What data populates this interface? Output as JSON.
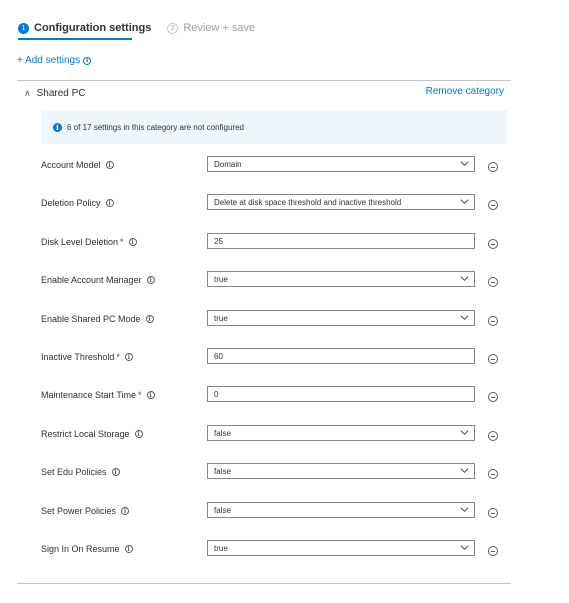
{
  "steps": [
    {
      "number": "1",
      "label": "Configuration settings"
    },
    {
      "number": "2",
      "label": "Review + save"
    }
  ],
  "add_settings_label": "+ Add settings",
  "info_glyph": "i",
  "category": {
    "title": "Shared PC",
    "remove_label": "Remove category",
    "banner_text": "6 of 17 settings in this category are not configured"
  },
  "settings": [
    {
      "label": "Account Model",
      "required": false,
      "type": "dropdown",
      "value": "Domain"
    },
    {
      "label": "Deletion Policy",
      "required": false,
      "type": "dropdown",
      "value": "Delete at disk space threshold and inactive threshold"
    },
    {
      "label": "Disk Level Deletion",
      "required": true,
      "type": "text",
      "value": "25"
    },
    {
      "label": "Enable Account Manager",
      "required": false,
      "type": "dropdown",
      "value": "true"
    },
    {
      "label": "Enable Shared PC Mode",
      "required": false,
      "type": "dropdown",
      "value": "true"
    },
    {
      "label": "Inactive Threshold",
      "required": true,
      "type": "text",
      "value": "60"
    },
    {
      "label": "Maintenance Start Time",
      "required": true,
      "type": "text",
      "value": "0"
    },
    {
      "label": "Restrict Local Storage",
      "required": false,
      "type": "dropdown",
      "value": "false"
    },
    {
      "label": "Set Edu Policies",
      "required": false,
      "type": "dropdown",
      "value": "false"
    },
    {
      "label": "Set Power Policies",
      "required": false,
      "type": "dropdown",
      "value": "false"
    },
    {
      "label": "Sign In On Resume",
      "required": false,
      "type": "dropdown",
      "value": "true"
    }
  ],
  "required_marker": "*",
  "colors": {
    "accent": "#0078d4",
    "banner_bg": "#eff6fc",
    "required": "#a4262c"
  }
}
